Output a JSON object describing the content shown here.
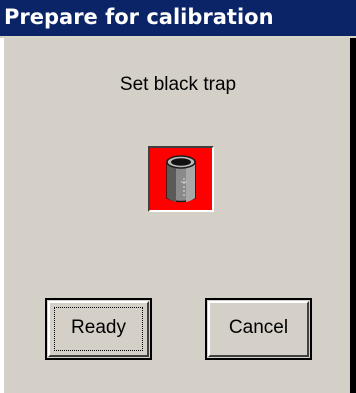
{
  "window": {
    "title": "Prepare for calibration"
  },
  "dialog": {
    "message": "Set black trap",
    "icon": "black-trap-icon",
    "icon_background": "#ff0000",
    "buttons": {
      "ready_label": "Ready",
      "cancel_label": "Cancel"
    }
  },
  "colors": {
    "titlebar": "#0a2467",
    "client": "#d4d0c8"
  }
}
